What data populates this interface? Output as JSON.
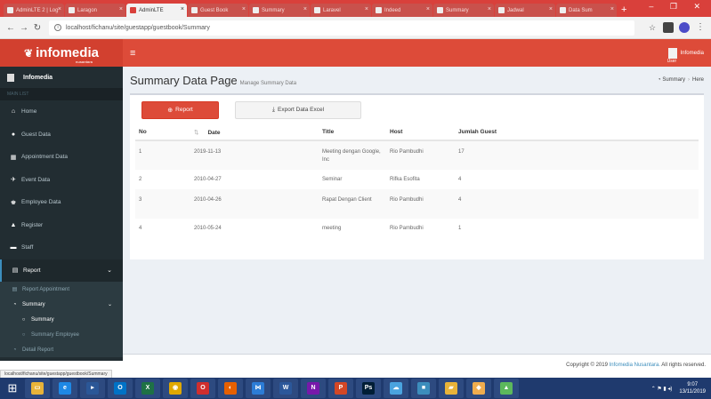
{
  "browser": {
    "tabs": [
      {
        "label": "AdminLTE 2 | Log",
        "active": false
      },
      {
        "label": "Laragon",
        "active": false
      },
      {
        "label": "AdminLTE",
        "active": true
      },
      {
        "label": "Guest Book",
        "active": false
      },
      {
        "label": "Summary",
        "active": false
      },
      {
        "label": "Laravel",
        "active": false
      },
      {
        "label": "Indeed",
        "active": false
      },
      {
        "label": "Summary",
        "active": false
      },
      {
        "label": "Jadwal",
        "active": false
      },
      {
        "label": "Data Sum",
        "active": false
      }
    ],
    "new_tab": "+",
    "window_controls": "– ❐ ✕",
    "url": "localhost/fichanu/site/guestapp/guestbook/Summary",
    "status_url": "localhost/fichanu/site/guestapp/guestbook/Summary"
  },
  "app": {
    "logo": "infomedia",
    "logo_sub": "nusantara",
    "user_name": "Infomedia",
    "user_label": "User"
  },
  "sidebar": {
    "user": "Infomedia",
    "section": "MAIN LIST",
    "items": [
      {
        "label": "Home",
        "icon": "home-icon",
        "glyph": "⌂"
      },
      {
        "label": "Guest Data",
        "icon": "user-icon",
        "glyph": "●"
      },
      {
        "label": "Appointment Data",
        "icon": "calendar-icon",
        "glyph": "▦"
      },
      {
        "label": "Event Data",
        "icon": "pin-icon",
        "glyph": "✈"
      },
      {
        "label": "Employee Data",
        "icon": "users-icon",
        "glyph": "♚"
      },
      {
        "label": "Register",
        "icon": "lock-icon",
        "glyph": "▲"
      },
      {
        "label": "Staff",
        "icon": "id-card-icon",
        "glyph": "▬"
      },
      {
        "label": "Report",
        "icon": "report-icon",
        "glyph": "▤"
      }
    ],
    "report_sub": [
      {
        "label": "Report Appointment",
        "icon": "table-icon",
        "glyph": "▤"
      },
      {
        "label": "Summary",
        "icon": "dashboard-icon",
        "glyph": "◔"
      },
      {
        "label": "Summary",
        "icon": "circle-icon",
        "glyph": "○"
      },
      {
        "label": "Summary Employee",
        "icon": "circle-icon",
        "glyph": "○"
      },
      {
        "label": "Detail Report",
        "icon": "dashboard-icon",
        "glyph": "◔"
      }
    ]
  },
  "page": {
    "title": "Summary Data Page",
    "subtitle": "Manage Summary Data",
    "breadcrumb": [
      "Summary",
      "Here"
    ],
    "report_button": "Report",
    "export_button": "Export Data Excel"
  },
  "table": {
    "headers": [
      "No",
      "Date",
      "Title",
      "Host",
      "Jumlah Guest"
    ],
    "sort_glyph": "⇅",
    "rows": [
      {
        "no": "1",
        "date": "2019-11-13",
        "title": "Meeting dengan Google, Inc",
        "host": "Rio Pambudhi",
        "guests": "17"
      },
      {
        "no": "2",
        "date": "2010-04-27",
        "title": "Seminar",
        "host": "Rifka Esofita",
        "guests": "4"
      },
      {
        "no": "3",
        "date": "2010-04-26",
        "title": "Rapat Dengan Client",
        "host": "Rio Pambudhi",
        "guests": "4"
      },
      {
        "no": "4",
        "date": "2010-05-24",
        "title": "meeting",
        "host": "Rio Pambudhi",
        "guests": "1"
      }
    ]
  },
  "footer": {
    "prefix": "Copyright © 2019 ",
    "brand": "Infomedia Nusantara.",
    "suffix": " All rights reserved."
  },
  "taskbar": {
    "apps": [
      {
        "icon": "file-explorer-icon",
        "glyph": "▭",
        "color": "#e8b339"
      },
      {
        "icon": "ie-icon",
        "glyph": "e",
        "color": "#1e88e5"
      },
      {
        "icon": "media-icon",
        "glyph": "▸",
        "color": "#2b5797"
      },
      {
        "icon": "outlook-icon",
        "glyph": "O",
        "color": "#0072c6"
      },
      {
        "icon": "excel-icon",
        "glyph": "X",
        "color": "#1e7145"
      },
      {
        "icon": "chrome-icon",
        "glyph": "◉",
        "color": "#e0a800"
      },
      {
        "icon": "opera-icon",
        "glyph": "O",
        "color": "#d02e2e"
      },
      {
        "icon": "firefox-icon",
        "glyph": "◐",
        "color": "#e66000"
      },
      {
        "icon": "vscode-icon",
        "glyph": "⋈",
        "color": "#2c7cd6"
      },
      {
        "icon": "word-icon",
        "glyph": "W",
        "color": "#2b579a"
      },
      {
        "icon": "onenote-icon",
        "glyph": "N",
        "color": "#7719aa"
      },
      {
        "icon": "powerpoint-icon",
        "glyph": "P",
        "color": "#d24726"
      },
      {
        "icon": "photoshop-icon",
        "glyph": "Ps",
        "color": "#001e36"
      },
      {
        "icon": "cloud-icon",
        "glyph": "☁",
        "color": "#4aa3df"
      },
      {
        "icon": "app-icon",
        "glyph": "■",
        "color": "#3c8dbc"
      },
      {
        "icon": "folder-icon",
        "glyph": "▰",
        "color": "#e8b339"
      },
      {
        "icon": "app2-icon",
        "glyph": "◆",
        "color": "#f0ad4e"
      },
      {
        "icon": "app3-icon",
        "glyph": "▲",
        "color": "#5cb85c"
      }
    ],
    "time": "9:07",
    "date": "13/11/2019"
  }
}
